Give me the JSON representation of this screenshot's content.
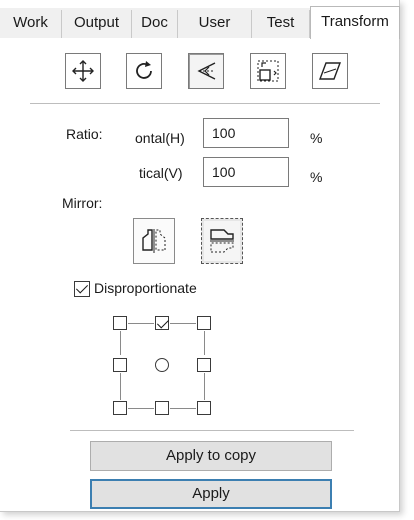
{
  "tabs": [
    {
      "label": "Work"
    },
    {
      "label": "Output"
    },
    {
      "label": "Doc"
    },
    {
      "label": "User"
    },
    {
      "label": "Test"
    },
    {
      "label": "Transform"
    }
  ],
  "toolbar": {
    "icons": [
      "move-icon",
      "rotate-icon",
      "skew-scale-icon",
      "size-icon",
      "slant-icon"
    ]
  },
  "ratio": {
    "label": "Ratio:",
    "horizontal_label": "ontal(H)",
    "horizontal_value": "100",
    "horizontal_unit": "%",
    "vertical_label": "tical(V)",
    "vertical_value": "100",
    "vertical_unit": "%"
  },
  "mirror": {
    "label": "Mirror:"
  },
  "disproportionate": {
    "label": "Disproportionate",
    "checked": true
  },
  "actions": {
    "apply_to_copy": "Apply to copy",
    "apply": "Apply"
  }
}
